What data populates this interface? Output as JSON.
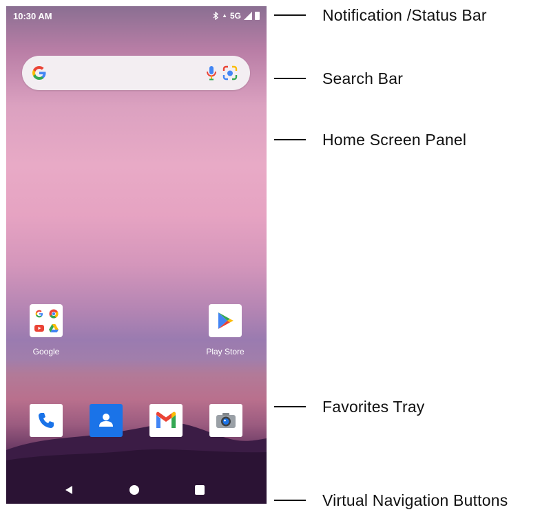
{
  "status_bar": {
    "time": "10:30 AM",
    "network": "5G",
    "icons": [
      "bluetooth-icon",
      "signal-icon",
      "battery-icon"
    ]
  },
  "search_bar": {
    "icons": [
      "google-g-icon",
      "microphone-icon",
      "google-lens-icon"
    ]
  },
  "home_apps": [
    {
      "label": "Google",
      "icon": "google-folder-icon"
    },
    {
      "label": "Play Store",
      "icon": "play-store-icon"
    }
  ],
  "dock": {
    "apps": [
      {
        "name": "Phone",
        "icon": "phone-icon"
      },
      {
        "name": "Contacts",
        "icon": "contacts-icon"
      },
      {
        "name": "Gmail",
        "icon": "gmail-icon"
      },
      {
        "name": "Camera",
        "icon": "camera-icon"
      }
    ]
  },
  "nav": {
    "icons": [
      "back-icon",
      "home-icon",
      "recents-icon"
    ]
  },
  "callouts": {
    "status": "Notification /Status Bar",
    "search": "Search Bar",
    "home_panel": "Home Screen Panel",
    "favorites": "Favorites Tray",
    "nav_buttons": "Virtual Navigation Buttons"
  },
  "colors": {
    "google_blue": "#4285F4",
    "google_red": "#EA4335",
    "google_yellow": "#FBBC05",
    "google_green": "#34A853",
    "contacts_blue": "#1a73e8",
    "label_text": "#111111"
  }
}
